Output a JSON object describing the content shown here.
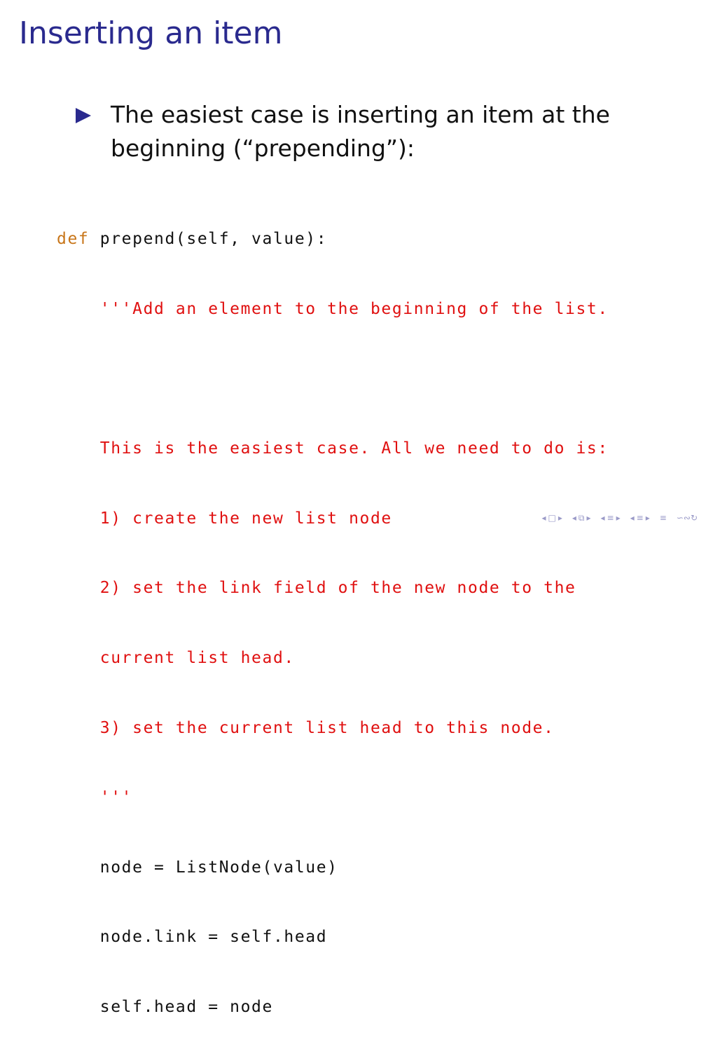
{
  "slide": {
    "title": "Inserting an item",
    "bullet": "The easiest case is inserting an item at the beginning (“prepending”):"
  },
  "code": {
    "keyword": "def",
    "signature": " prepend(self, value):",
    "lines": [
      "    '''Add an element to the beginning of the list.",
      "",
      "    This is the easiest case. All we need to do is:",
      "    1) create the new list node",
      "    2) set the link field of the new node to the",
      "    current list head.",
      "    3) set the current list head to this node.",
      "    '''",
      "    node = ListNode(value)",
      "    node.link = self.head",
      "    self.head = node"
    ]
  },
  "nav": {
    "frame_prev": "◂",
    "frame_icon": "□",
    "frame_next": "▸",
    "subsection_prev": "◂",
    "subsection_icon": "⧉",
    "subsection_next": "▸",
    "section_prev": "◂",
    "section_icon": "≡",
    "section_next": "▸",
    "doc_prev": "◂",
    "doc_icon": "≡",
    "doc_next": "▸",
    "align_icon": "≡",
    "search_icons": "∽∾↻"
  }
}
